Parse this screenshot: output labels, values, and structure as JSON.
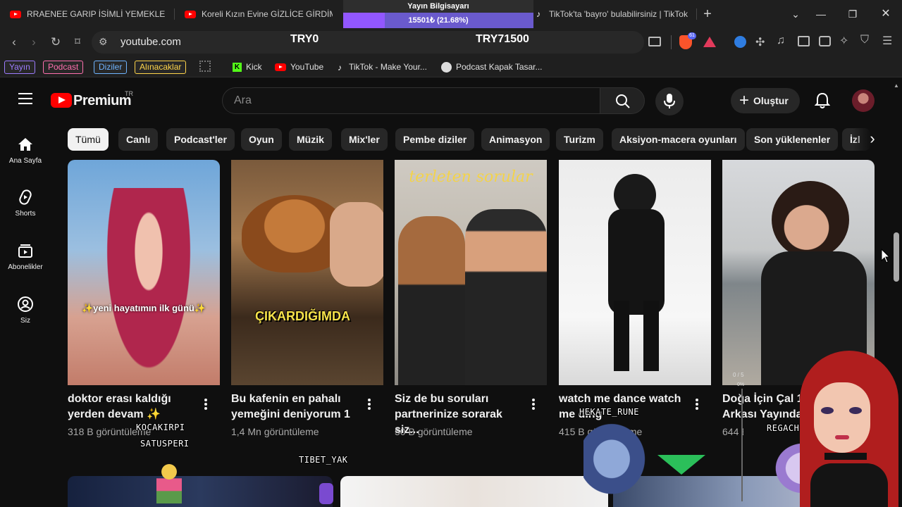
{
  "browser": {
    "tabs": [
      {
        "title": "RRAENEE GARIP İSİMLİ YEMEKLERİ İN"
      },
      {
        "title": "Koreli Kızın Evine GİZLİCE GİRDİM!"
      },
      {
        "title": "TikTok'ta 'bayro' bulabilirsiniz | TikTok"
      }
    ],
    "new_tab_glyph": "+",
    "url": "youtube.com"
  },
  "stream_overlay": {
    "broadcast_title": "Yayın Bilgisayarı",
    "progress_text": "15501₺ (21.68%)",
    "progress_fraction": 0.2168,
    "goal_left": "TRY0",
    "goal_right": "TRY71500",
    "viewer_labels": [
      "KOCAKIRPI",
      "SATUSPERI",
      "TIBET_YAK",
      "HEKATE_RUNE",
      "REGACHIE"
    ],
    "mini_counter": "0 / 5",
    "mini_percent": "0%"
  },
  "bookmarks": {
    "chips": [
      {
        "label": "Yayın",
        "color": "#9d7cff"
      },
      {
        "label": "Podcast",
        "color": "#ff6fae"
      },
      {
        "label": "Diziler",
        "color": "#6fb4ff"
      },
      {
        "label": "Alınacaklar",
        "color": "#ffd54a"
      }
    ],
    "links": [
      {
        "label": "Kick",
        "icon": "kick-icon"
      },
      {
        "label": "YouTube",
        "icon": "youtube-icon"
      },
      {
        "label": "TikTok - Make Your...",
        "icon": "tiktok-icon"
      },
      {
        "label": "Podcast Kapak Tasar...",
        "icon": "podcast-cover-icon"
      }
    ]
  },
  "youtube": {
    "logo_text": "Premium",
    "logo_region": "TR",
    "search_placeholder": "Ara",
    "create_label": "Oluştur",
    "sidebar": [
      {
        "label": "Ana Sayfa",
        "icon": "home-icon"
      },
      {
        "label": "Shorts",
        "icon": "shorts-icon"
      },
      {
        "label": "Abonelikler",
        "icon": "subscriptions-icon"
      },
      {
        "label": "Siz",
        "icon": "you-icon"
      }
    ],
    "chips": [
      "Tümü",
      "Canlı",
      "Podcast'ler",
      "Oyun",
      "Müzik",
      "Mix'ler",
      "Pembe diziler",
      "Animasyon",
      "Turizm",
      "Aksiyon-macera oyunları",
      "Son yüklenenler",
      "İzl"
    ],
    "shorts": [
      {
        "title_line1": "doktor erası kaldığı",
        "title_line2": "yerden devam ✨",
        "views": "318 B görüntüleme",
        "caption": "✨yeni hayatımın ilk günü✨"
      },
      {
        "title_line1": "Bu kafenin en pahalı",
        "title_line2": "yemeğini deniyorum 1",
        "views": "1,4 Mn görüntüleme",
        "caption": "ÇIKARDIĞIMDA"
      },
      {
        "title_line1": "Siz de bu soruları",
        "title_line2": "partnerinize sorarak siz...",
        "views": "50 B görüntüleme",
        "caption": "terleten sorular"
      },
      {
        "title_line1": "watch me dance watch",
        "title_line2": "me ding",
        "views": "415 B görüntüleme",
        "caption": ""
      },
      {
        "title_line1": "Doğa İçin Çal 1",
        "title_line2": "Arkası Yayında",
        "views": "644 B görüntüleme",
        "caption": ""
      }
    ]
  }
}
